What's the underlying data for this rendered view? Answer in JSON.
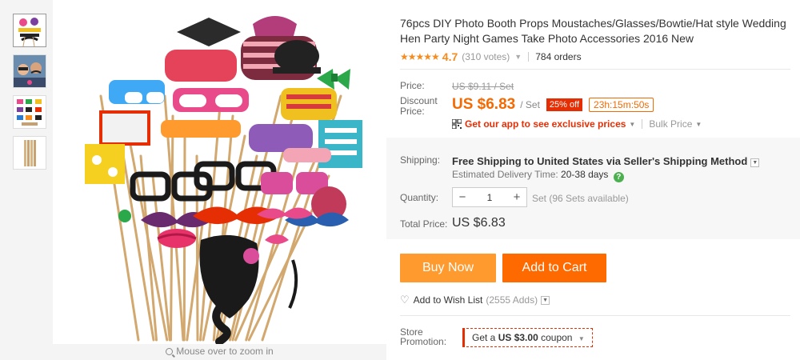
{
  "gallery": {
    "thumbnails": [
      {
        "name": "props-fan-thumb"
      },
      {
        "name": "people-photo-thumb"
      },
      {
        "name": "props-laid-out-thumb"
      },
      {
        "name": "wooden-sticks-thumb"
      }
    ],
    "zoom_hint": "Mouse over to zoom in"
  },
  "product": {
    "title": "76pcs DIY Photo Booth Props Moustaches/Glasses/Bowtie/Hat style Wedding Hen Party Night Games Take Photo Accessories 2016 New",
    "stars": "★★★★★",
    "rating": "4.7",
    "votes": "(310 votes)",
    "orders": "784 orders"
  },
  "pricing": {
    "price_label": "Price:",
    "old_price": "US $9.11 / Set",
    "discount_label_line1": "Discount",
    "discount_label_line2": "Price:",
    "discount_price": "US $6.83",
    "unit": "/ Set",
    "discount_badge": "25% off",
    "timer": "23h:15m:50s",
    "app_link": "Get our app to see exclusive prices",
    "bulk_price": "Bulk Price"
  },
  "shipping": {
    "label": "Shipping:",
    "method": "Free Shipping to United States via Seller's Shipping Method",
    "estimate_label": "Estimated Delivery Time:",
    "estimate_days": "20-38 days",
    "help": "?"
  },
  "quantity": {
    "label": "Quantity:",
    "value": "1",
    "minus": "−",
    "plus": "+",
    "available": "Set (96 Sets available)"
  },
  "total": {
    "label": "Total Price:",
    "value": "US $6.83"
  },
  "actions": {
    "buy_now": "Buy Now",
    "add_to_cart": "Add to Cart",
    "wish_list": "Add to Wish List",
    "wish_count": "(2555 Adds)"
  },
  "promotion": {
    "label_line1": "Store",
    "label_line2": "Promotion:",
    "coupon_prefix": "Get a",
    "coupon_amount": "US $3.00",
    "coupon_suffix": "coupon"
  },
  "colors": {
    "accent_orange": "#ff6a00",
    "buy_now": "#ff9a2e",
    "red": "#e62e04",
    "star": "#f68b1e"
  }
}
